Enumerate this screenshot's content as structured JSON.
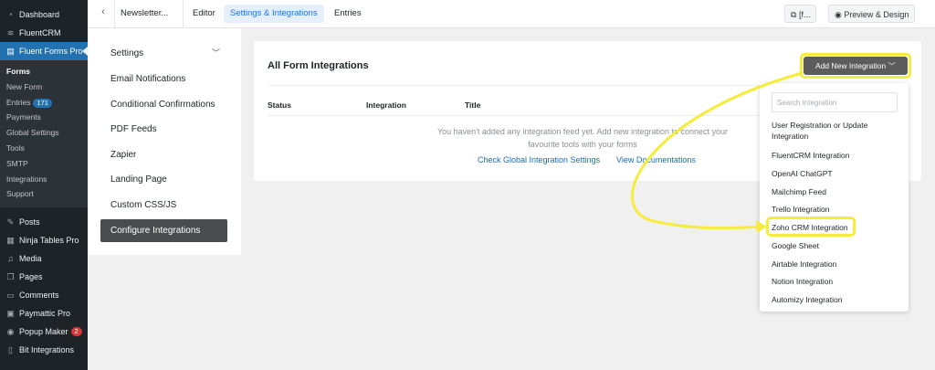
{
  "wp_menu": {
    "top_items": [
      {
        "label": "Dashboard",
        "icon": "dashboard-icon"
      },
      {
        "label": "FluentCRM",
        "icon": "fluentcrm-icon"
      }
    ],
    "active_item": {
      "label": "Fluent Forms Pro",
      "icon": "fluent-forms-icon"
    },
    "sub_items": [
      {
        "label": "Forms"
      },
      {
        "label": "New Form"
      },
      {
        "label": "Entries",
        "badge": "171"
      },
      {
        "label": "Payments"
      },
      {
        "label": "Global Settings"
      },
      {
        "label": "Tools"
      },
      {
        "label": "SMTP"
      },
      {
        "label": "Integrations"
      },
      {
        "label": "Support"
      }
    ],
    "bottom_items": [
      {
        "label": "Posts",
        "icon": "pin-icon"
      },
      {
        "label": "Ninja Tables Pro",
        "icon": "table-icon"
      },
      {
        "label": "Media",
        "icon": "media-icon"
      },
      {
        "label": "Pages",
        "icon": "pages-icon"
      },
      {
        "label": "Comments",
        "icon": "comment-icon"
      },
      {
        "label": "Paymattic Pro",
        "icon": "payment-icon"
      },
      {
        "label": "Popup Maker",
        "icon": "popup-icon",
        "badge": "2"
      },
      {
        "label": "Bit Integrations",
        "icon": "bit-icon"
      }
    ]
  },
  "topbar": {
    "form_name": "Newsletter...",
    "tabs": [
      "Editor",
      "Settings & Integrations",
      "Entries"
    ],
    "shortcode_label": "[f...",
    "preview_label": "Preview & Design"
  },
  "settings_menu": {
    "items": [
      "Settings",
      "Email Notifications",
      "Conditional Confirmations",
      "PDF Feeds",
      "Zapier",
      "Landing Page",
      "Custom CSS/JS",
      "Configure Integrations"
    ]
  },
  "integrations": {
    "title": "All Form Integrations",
    "add_button": "Add New Integration",
    "columns": [
      "Status",
      "Integration",
      "Title"
    ],
    "empty_line1": "You haven't added any integration feed yet. Add new integration to connect your",
    "empty_line2": "favourite tools with your forms",
    "link_global": "Check Global Integration Settings",
    "link_docs": "View Documentations"
  },
  "dropdown": {
    "search_placeholder": "Search Integration",
    "items": [
      "User Registration or Update Integration",
      "FluentCRM Integration",
      "OpenAI ChatGPT",
      "Mailchimp Feed",
      "Trello Integration",
      "Zoho CRM Integration",
      "Google Sheet",
      "Airtable Integration",
      "Notion Integration",
      "Automizy Integration"
    ]
  },
  "colors": {
    "highlight": "#f5ec3c",
    "wp_sidebar": "#1d2327",
    "wp_active": "#2271b1",
    "link": "#1a6bc1",
    "active_tab": "#1a73e8"
  }
}
